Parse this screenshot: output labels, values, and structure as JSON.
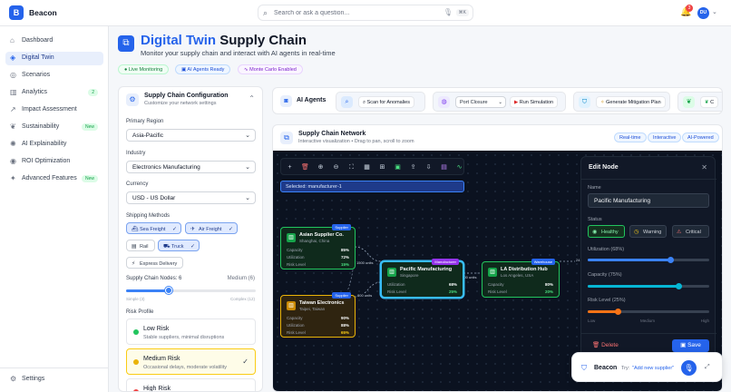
{
  "app": {
    "brand": "Beacon",
    "logo_glyph": "B",
    "search_placeholder": "Search or ask a question...",
    "search_shortcut": "⌘K",
    "notifications_count": "3",
    "user_initials": "DU"
  },
  "sidebar": {
    "items": [
      {
        "label": "Dashboard",
        "icon": "home-icon"
      },
      {
        "label": "Digital Twin",
        "icon": "cube-icon",
        "active": true
      },
      {
        "label": "Scenarios",
        "icon": "layers-icon"
      },
      {
        "label": "Analytics",
        "icon": "bar-chart-icon",
        "badge": "2"
      },
      {
        "label": "Impact Assessment",
        "icon": "trend-icon"
      },
      {
        "label": "Sustainability",
        "icon": "leaf-icon",
        "badge": "New"
      },
      {
        "label": "AI Explainability",
        "icon": "brain-icon"
      },
      {
        "label": "ROI Optimization",
        "icon": "target-icon"
      },
      {
        "label": "Advanced Features",
        "icon": "sparkles-icon",
        "badge": "New"
      }
    ],
    "settings_label": "Settings"
  },
  "header": {
    "title_highlight": "Digital Twin",
    "title_rest": " Supply Chain",
    "subtitle": "Monitor your supply chain and interact with AI agents in real-time",
    "pills": [
      "Live Monitoring",
      "AI Agents Ready",
      "Monte Carlo Enabled"
    ]
  },
  "config": {
    "title": "Supply Chain Configuration",
    "subtitle": "Customize your network settings",
    "primary_region_label": "Primary Region",
    "primary_region_value": "Asia-Pacific",
    "industry_label": "Industry",
    "industry_value": "Electronics Manufacturing",
    "currency_label": "Currency",
    "currency_value": "USD - US Dollar",
    "shipping_label": "Shipping Methods",
    "shipping": [
      {
        "label": "Sea Freight",
        "selected": true
      },
      {
        "label": "Air Freight",
        "selected": true
      },
      {
        "label": "Rail",
        "selected": false
      },
      {
        "label": "Truck",
        "selected": true
      },
      {
        "label": "Express Delivery",
        "selected": false
      }
    ],
    "nodes_label": "Supply Chain Nodes: 6",
    "nodes_level": "Medium (6)",
    "nodes_min_label": "Simple (3)",
    "nodes_max_label": "Complex (12)",
    "nodes_fraction": 0.33,
    "risk_label": "Risk Profile",
    "risks": [
      {
        "name": "Low Risk",
        "desc": "Stable suppliers, minimal disruptions",
        "color": "#22c55e",
        "selected": false
      },
      {
        "name": "Medium Risk",
        "desc": "Occasional delays, moderate volatility",
        "color": "#eab308",
        "selected": true
      },
      {
        "name": "High Risk",
        "desc": "",
        "color": "#ef4444",
        "selected": false
      }
    ]
  },
  "agents": {
    "title": "AI Agents",
    "scan_label": "Scan for Anomalies",
    "scenario_value": "Port Closure",
    "run_label": "Run Simulation",
    "mitigation_label": "Generate Mitigation Plan",
    "extra_label": "C"
  },
  "network": {
    "title": "Supply Chain Network",
    "subtitle": "Interactive visualization • Drag to pan, scroll to zoom",
    "tags": [
      "Real-time",
      "Interactive",
      "AI-Powered"
    ],
    "selected_text": "Selected: manufacturer-1",
    "nodes": [
      {
        "name": "Asian Supplier Co.",
        "location": "Shanghai, China",
        "type": "Supplier",
        "capacity": "85%",
        "utilization": "72%",
        "risk": "15%",
        "accent": "#22c55e"
      },
      {
        "name": "Taiwan Electronics",
        "location": "Taipei, Taiwan",
        "type": "Supplier",
        "capacity": "90%",
        "utilization": "88%",
        "risk": "65%",
        "accent": "#eab308"
      },
      {
        "name": "Pacific Manufacturing",
        "location": "Singapore",
        "type": "Manufacturer",
        "utilization": "68%",
        "risk": "25%",
        "accent": "#22c55e"
      },
      {
        "name": "LA Distribution Hub",
        "location": "Los Angeles, USA",
        "type": "Warehouse",
        "capacity": "80%",
        "risk": "20%",
        "accent": "#22c55e"
      }
    ],
    "labels": {
      "capacity": "Capacity",
      "utilization": "Utilization",
      "risk": "Risk Level"
    },
    "edges": [
      "1500 units",
      "800 units",
      "1800 units",
      "24"
    ]
  },
  "edit_node": {
    "title": "Edit Node",
    "name_label": "Name",
    "name_value": "Pacific Manufacturing",
    "status_label": "Status",
    "statuses": [
      "Healthy",
      "Warning",
      "Critical"
    ],
    "active_status": "Healthy",
    "utilization_label": "Utilization (68%)",
    "utilization_fraction": 0.68,
    "capacity_label": "Capacity (75%)",
    "capacity_fraction": 0.75,
    "risk_label": "Risk Level (25%)",
    "risk_fraction": 0.25,
    "risk_ticks": [
      "Low",
      "Medium",
      "High"
    ],
    "delete_label": "Delete",
    "save_label": "Save"
  },
  "assistant": {
    "name": "Beacon",
    "try_label": "Try:",
    "example": "\"Add new supplier\""
  },
  "colors": {
    "accent": "#2563eb",
    "healthy": "#22c55e",
    "warning": "#eab308",
    "critical": "#ef4444",
    "canvas_bg": "#0b1220"
  }
}
